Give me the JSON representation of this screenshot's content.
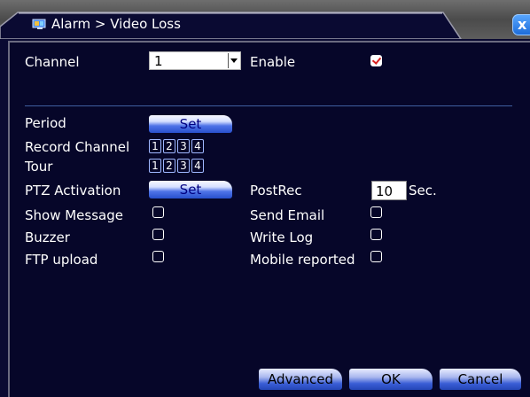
{
  "window": {
    "title": "Alarm > Video Loss",
    "close_glyph": "x",
    "title_icon": "monitor-icon"
  },
  "form": {
    "channel_label": "Channel",
    "channel_value": "1",
    "enable_label": "Enable",
    "enable_checked": true,
    "period_label": "Period",
    "period_button": "Set",
    "record_channel_label": "Record Channel",
    "record_channels": [
      "1",
      "2",
      "3",
      "4"
    ],
    "tour_label": "Tour",
    "tour_channels": [
      "1",
      "2",
      "3",
      "4"
    ],
    "ptz_label": "PTZ Activation",
    "ptz_button": "Set",
    "postrec_label": "PostRec",
    "postrec_value": "10",
    "postrec_unit": "Sec.",
    "show_message_label": "Show Message",
    "send_email_label": "Send Email",
    "buzzer_label": "Buzzer",
    "write_log_label": "Write Log",
    "ftp_upload_label": "FTP upload",
    "mobile_reported_label": "Mobile reported"
  },
  "buttons": {
    "advanced": "Advanced",
    "ok": "OK",
    "cancel": "Cancel"
  },
  "colors": {
    "background": "#0a0a32",
    "accent": "#2850cc",
    "check_mark": "#d92020"
  }
}
